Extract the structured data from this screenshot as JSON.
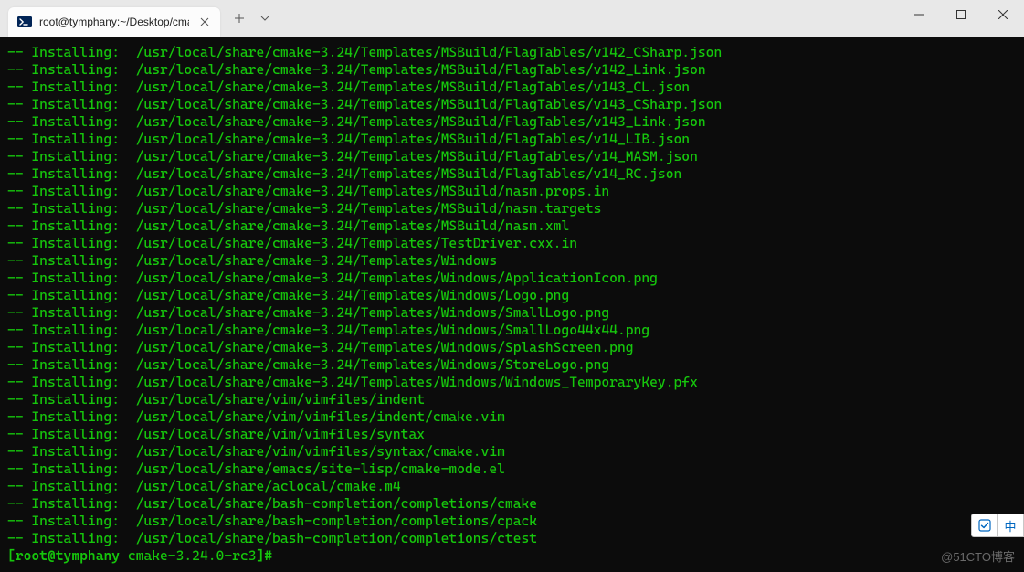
{
  "tab": {
    "title": "root@tymphany:~/Desktop/cmak"
  },
  "installPrefix": "-- Installing:  ",
  "installPaths": [
    "/usr/local/share/cmake-3.24/Templates/MSBuild/FlagTables/v142_CSharp.json",
    "/usr/local/share/cmake-3.24/Templates/MSBuild/FlagTables/v142_Link.json",
    "/usr/local/share/cmake-3.24/Templates/MSBuild/FlagTables/v143_CL.json",
    "/usr/local/share/cmake-3.24/Templates/MSBuild/FlagTables/v143_CSharp.json",
    "/usr/local/share/cmake-3.24/Templates/MSBuild/FlagTables/v143_Link.json",
    "/usr/local/share/cmake-3.24/Templates/MSBuild/FlagTables/v14_LIB.json",
    "/usr/local/share/cmake-3.24/Templates/MSBuild/FlagTables/v14_MASM.json",
    "/usr/local/share/cmake-3.24/Templates/MSBuild/FlagTables/v14_RC.json",
    "/usr/local/share/cmake-3.24/Templates/MSBuild/nasm.props.in",
    "/usr/local/share/cmake-3.24/Templates/MSBuild/nasm.targets",
    "/usr/local/share/cmake-3.24/Templates/MSBuild/nasm.xml",
    "/usr/local/share/cmake-3.24/Templates/TestDriver.cxx.in",
    "/usr/local/share/cmake-3.24/Templates/Windows",
    "/usr/local/share/cmake-3.24/Templates/Windows/ApplicationIcon.png",
    "/usr/local/share/cmake-3.24/Templates/Windows/Logo.png",
    "/usr/local/share/cmake-3.24/Templates/Windows/SmallLogo.png",
    "/usr/local/share/cmake-3.24/Templates/Windows/SmallLogo44x44.png",
    "/usr/local/share/cmake-3.24/Templates/Windows/SplashScreen.png",
    "/usr/local/share/cmake-3.24/Templates/Windows/StoreLogo.png",
    "/usr/local/share/cmake-3.24/Templates/Windows/Windows_TemporaryKey.pfx",
    "/usr/local/share/vim/vimfiles/indent",
    "/usr/local/share/vim/vimfiles/indent/cmake.vim",
    "/usr/local/share/vim/vimfiles/syntax",
    "/usr/local/share/vim/vimfiles/syntax/cmake.vim",
    "/usr/local/share/emacs/site-lisp/cmake-mode.el",
    "/usr/local/share/aclocal/cmake.m4",
    "/usr/local/share/bash-completion/completions/cmake",
    "/usr/local/share/bash-completion/completions/cpack",
    "/usr/local/share/bash-completion/completions/ctest"
  ],
  "prompt": {
    "open": "[",
    "userHost": "root@tymphany",
    "sep": " ",
    "cwd": "cmake-3.24.0-rc3",
    "close": "]#"
  },
  "ime": {
    "mode": "中"
  },
  "watermark": "@51CTO博客"
}
